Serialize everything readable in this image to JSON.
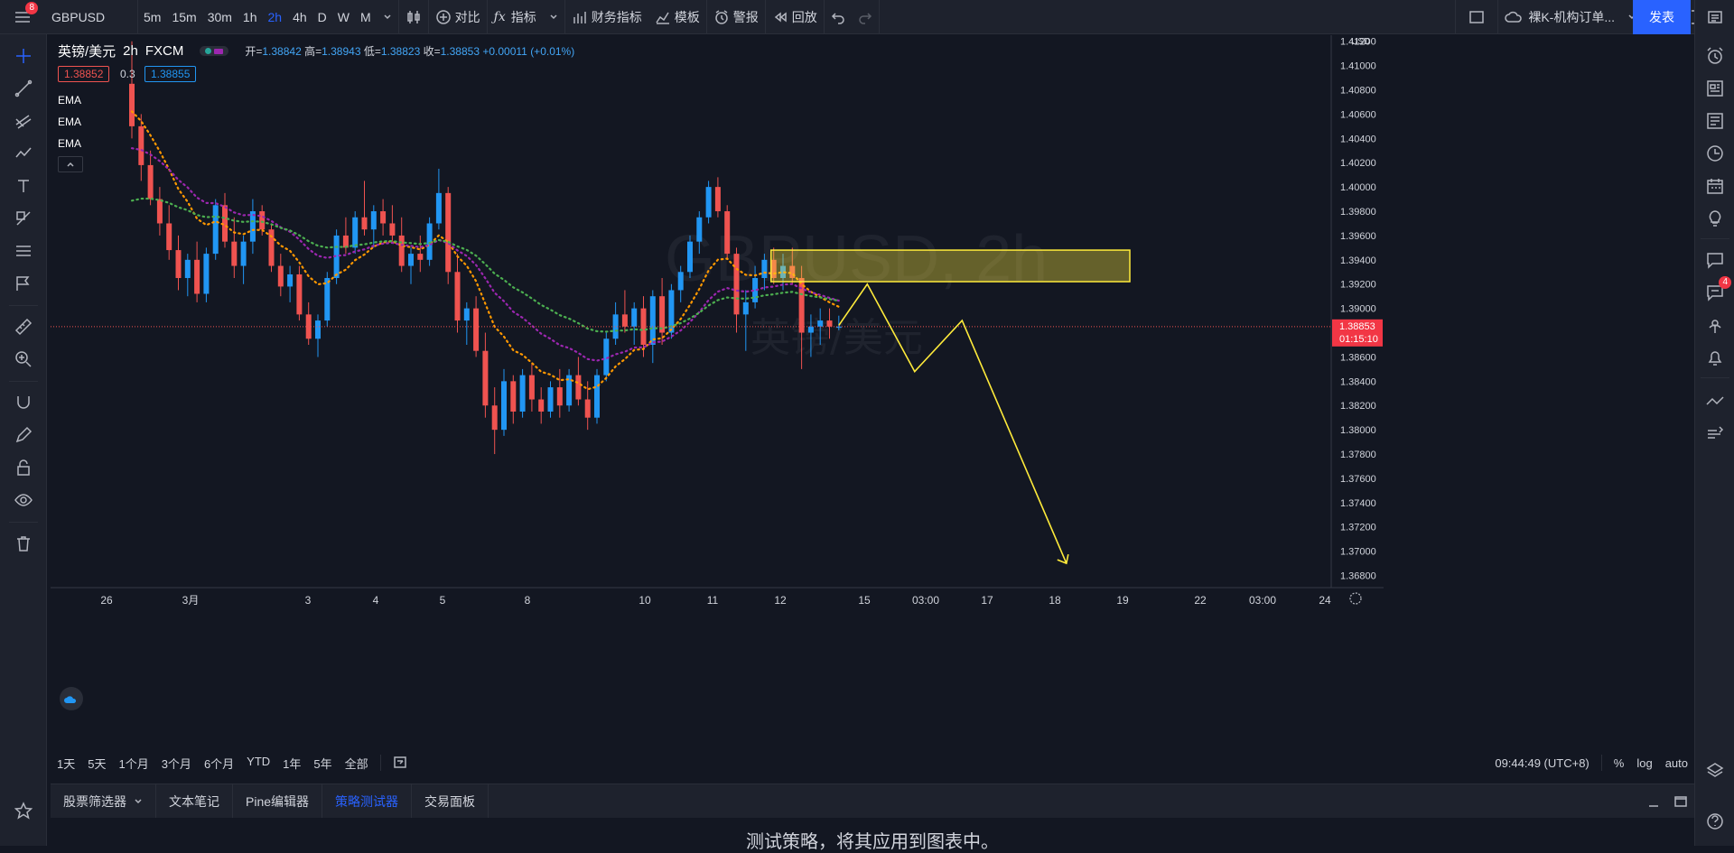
{
  "topbar": {
    "notification_count": "8",
    "symbol": "GBPUSD",
    "intervals": [
      "5m",
      "15m",
      "30m",
      "1h",
      "2h",
      "4h",
      "D",
      "W",
      "M"
    ],
    "active_interval": "2h",
    "compare_label": "对比",
    "indicators_label": "指标",
    "financials_label": "财务指标",
    "templates_label": "模板",
    "alert_label": "警报",
    "replay_label": "回放",
    "layout_name": "裸K-机构订单...",
    "publish_label": "发表"
  },
  "legend": {
    "title": "英镑/美元",
    "interval": "2h",
    "exchange": "FXCM",
    "open_label": "开=",
    "open": "1.38842",
    "high_label": "高=",
    "high": "1.38943",
    "low_label": "低=",
    "low": "1.38823",
    "close_label": "收=",
    "close": "1.38853",
    "change": "+0.00011 (+0.01%)",
    "bid": "1.38852",
    "spread": "0.3",
    "ask": "1.38855",
    "ema_labels": [
      "EMA",
      "EMA",
      "EMA"
    ]
  },
  "price_axis": {
    "currency": "USD",
    "ticks": [
      "1.41200",
      "1.41000",
      "1.40800",
      "1.40600",
      "1.40400",
      "1.40200",
      "1.40000",
      "1.39800",
      "1.39600",
      "1.39400",
      "1.39200",
      "1.39000",
      "1.38800",
      "1.38600",
      "1.38400",
      "1.38200",
      "1.38000",
      "1.37800",
      "1.37600",
      "1.37400",
      "1.37200",
      "1.37000",
      "1.36800"
    ],
    "current_price": "1.38853",
    "countdown": "01:15:10"
  },
  "time_axis": {
    "ticks": [
      "26",
      "3月",
      "3",
      "4",
      "5",
      "8",
      "10",
      "11",
      "12",
      "15",
      "03:00",
      "17",
      "18",
      "19",
      "22",
      "03:00",
      "24"
    ]
  },
  "watermark": {
    "symbol": "GBPUSD, 2h",
    "name": "英镑/美元"
  },
  "bottombar": {
    "ranges": [
      "1天",
      "5天",
      "1个月",
      "3个月",
      "6个月",
      "YTD",
      "1年",
      "5年",
      "全部"
    ],
    "clock": "09:44:49 (UTC+8)",
    "percent_label": "%",
    "log_label": "log",
    "auto_label": "auto"
  },
  "tabs": {
    "items": [
      "股票筛选器",
      "文本笔记",
      "Pine编辑器",
      "策略测试器",
      "交易面板"
    ],
    "active": "策略测试器"
  },
  "panel": {
    "message": "测试策略，将其应用到图表中。"
  },
  "right_sidebar": {
    "chat_badge": "4"
  },
  "colors": {
    "background": "#131722",
    "up_candle": "#2196f3",
    "down_candle": "#ef5350",
    "ema_fast": "#ff9800",
    "ema_mid": "#9c27b0",
    "ema_slow": "#4caf50",
    "zone": "#ffeb3b",
    "accent": "#2962ff"
  },
  "chart_data": {
    "type": "candlestick",
    "symbol": "GBPUSD",
    "interval": "2h",
    "ylim": [
      1.367,
      1.4125
    ],
    "ohlc": [
      [
        1.4085,
        1.412,
        1.404,
        1.405
      ],
      [
        1.405,
        1.406,
        1.4005,
        1.4018
      ],
      [
        1.4018,
        1.403,
        1.3985,
        1.399
      ],
      [
        1.399,
        1.4,
        1.396,
        1.397
      ],
      [
        1.397,
        1.3985,
        1.394,
        1.3948
      ],
      [
        1.3948,
        1.396,
        1.3915,
        1.3925
      ],
      [
        1.3925,
        1.3945,
        1.391,
        1.394
      ],
      [
        1.394,
        1.3955,
        1.3905,
        1.3912
      ],
      [
        1.3912,
        1.395,
        1.3905,
        1.3945
      ],
      [
        1.3945,
        1.399,
        1.394,
        1.3985
      ],
      [
        1.3985,
        1.3995,
        1.395,
        1.3955
      ],
      [
        1.3955,
        1.3975,
        1.3925,
        1.3935
      ],
      [
        1.3935,
        1.396,
        1.392,
        1.3955
      ],
      [
        1.3955,
        1.399,
        1.3945,
        1.398
      ],
      [
        1.398,
        1.3985,
        1.396,
        1.3965
      ],
      [
        1.3965,
        1.397,
        1.393,
        1.3935
      ],
      [
        1.3935,
        1.3945,
        1.391,
        1.3918
      ],
      [
        1.3918,
        1.3935,
        1.3905,
        1.3928
      ],
      [
        1.3928,
        1.3935,
        1.389,
        1.3895
      ],
      [
        1.3895,
        1.3905,
        1.387,
        1.3875
      ],
      [
        1.3875,
        1.3895,
        1.386,
        1.389
      ],
      [
        1.389,
        1.393,
        1.3885,
        1.3925
      ],
      [
        1.3925,
        1.3965,
        1.392,
        1.396
      ],
      [
        1.396,
        1.3975,
        1.3945,
        1.395
      ],
      [
        1.395,
        1.398,
        1.3945,
        1.3975
      ],
      [
        1.3975,
        1.4005,
        1.396,
        1.3965
      ],
      [
        1.3965,
        1.3985,
        1.395,
        1.398
      ],
      [
        1.398,
        1.399,
        1.396,
        1.397
      ],
      [
        1.397,
        1.3985,
        1.3955,
        1.396
      ],
      [
        1.396,
        1.3975,
        1.393,
        1.3935
      ],
      [
        1.3935,
        1.395,
        1.392,
        1.3945
      ],
      [
        1.3945,
        1.396,
        1.393,
        1.394
      ],
      [
        1.394,
        1.3975,
        1.3935,
        1.397
      ],
      [
        1.397,
        1.4015,
        1.3965,
        1.3995
      ],
      [
        1.3995,
        1.4,
        1.392,
        1.393
      ],
      [
        1.393,
        1.3945,
        1.388,
        1.389
      ],
      [
        1.389,
        1.3905,
        1.387,
        1.39
      ],
      [
        1.39,
        1.391,
        1.386,
        1.3865
      ],
      [
        1.3865,
        1.388,
        1.381,
        1.382
      ],
      [
        1.382,
        1.3835,
        1.378,
        1.38
      ],
      [
        1.38,
        1.385,
        1.3795,
        1.384
      ],
      [
        1.384,
        1.3845,
        1.3805,
        1.3815
      ],
      [
        1.3815,
        1.385,
        1.381,
        1.3845
      ],
      [
        1.3845,
        1.3855,
        1.3815,
        1.3825
      ],
      [
        1.3825,
        1.3835,
        1.3805,
        1.3815
      ],
      [
        1.3815,
        1.384,
        1.381,
        1.3835
      ],
      [
        1.3835,
        1.385,
        1.381,
        1.382
      ],
      [
        1.382,
        1.385,
        1.3815,
        1.3845
      ],
      [
        1.3845,
        1.386,
        1.382,
        1.3825
      ],
      [
        1.3825,
        1.384,
        1.38,
        1.381
      ],
      [
        1.381,
        1.385,
        1.3805,
        1.3845
      ],
      [
        1.3845,
        1.388,
        1.384,
        1.3875
      ],
      [
        1.3875,
        1.3905,
        1.387,
        1.3895
      ],
      [
        1.3895,
        1.3915,
        1.388,
        1.3885
      ],
      [
        1.3885,
        1.3905,
        1.387,
        1.39
      ],
      [
        1.39,
        1.391,
        1.386,
        1.387
      ],
      [
        1.387,
        1.3915,
        1.3855,
        1.391
      ],
      [
        1.391,
        1.3925,
        1.387,
        1.388
      ],
      [
        1.388,
        1.392,
        1.3875,
        1.3915
      ],
      [
        1.3915,
        1.3935,
        1.3905,
        1.393
      ],
      [
        1.393,
        1.396,
        1.3925,
        1.3955
      ],
      [
        1.3955,
        1.398,
        1.3945,
        1.3975
      ],
      [
        1.3975,
        1.4005,
        1.397,
        1.4
      ],
      [
        1.4,
        1.4008,
        1.3975,
        1.398
      ],
      [
        1.398,
        1.3985,
        1.394,
        1.3945
      ],
      [
        1.3945,
        1.395,
        1.388,
        1.3895
      ],
      [
        1.3895,
        1.3915,
        1.3865,
        1.3905
      ],
      [
        1.3905,
        1.3935,
        1.39,
        1.3925
      ],
      [
        1.3925,
        1.3945,
        1.3915,
        1.394
      ],
      [
        1.394,
        1.395,
        1.392,
        1.3925
      ],
      [
        1.3925,
        1.3945,
        1.3915,
        1.3935
      ],
      [
        1.3935,
        1.395,
        1.392,
        1.3925
      ],
      [
        1.3925,
        1.3935,
        1.385,
        1.388
      ],
      [
        1.388,
        1.3895,
        1.386,
        1.3885
      ],
      [
        1.3885,
        1.39,
        1.387,
        1.389
      ],
      [
        1.389,
        1.39,
        1.3875,
        1.3885
      ],
      [
        1.3884,
        1.3894,
        1.3882,
        1.3885
      ]
    ],
    "ema_fast_start": 1.4065,
    "ema_mid_start": 1.403,
    "ema_slow_start": 1.3985,
    "supply_zone": {
      "top": 1.3948,
      "bottom": 1.3922
    },
    "projection_path": [
      [
        1.3886,
        "now"
      ],
      [
        1.392,
        "+3"
      ],
      [
        1.3848,
        "+8"
      ],
      [
        1.389,
        "+13"
      ],
      [
        1.369,
        "+24"
      ]
    ]
  }
}
